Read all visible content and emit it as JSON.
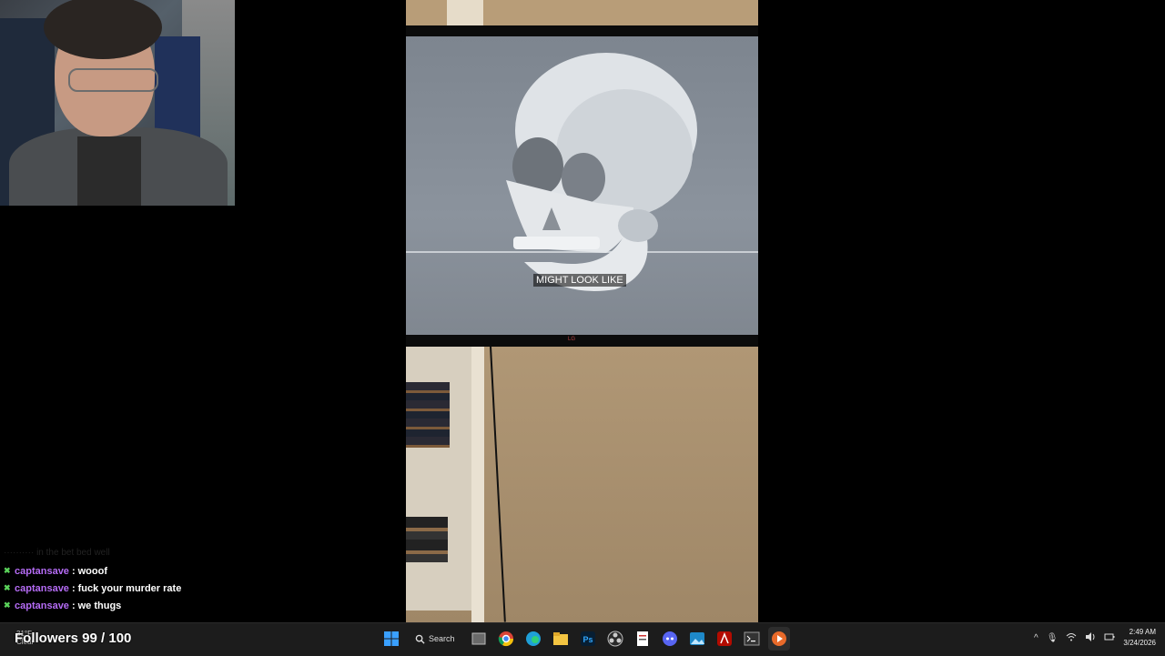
{
  "video": {
    "subtitle": "MIGHT LOOK LIKE"
  },
  "chat": {
    "faded_line": "·········· in the bet bed well",
    "messages": [
      {
        "user": "captansave",
        "text": "wooof"
      },
      {
        "user": "captansave",
        "text": "fuck your murder rate"
      },
      {
        "user": "captansave",
        "text": "we thugs"
      }
    ]
  },
  "overlay": {
    "followers": "Followers 99 / 100"
  },
  "taskbar": {
    "weather_temp": "31°F",
    "weather_label": "Clear",
    "search_label": "Search",
    "time": "2:49 AM",
    "date": "3/24/2026",
    "apps": [
      "windows-start",
      "search",
      "task-view",
      "chrome",
      "edge",
      "file-explorer",
      "photoshop",
      "obs",
      "notepad",
      "discord",
      "photos",
      "adobe-acrobat",
      "terminal",
      "media-player"
    ]
  },
  "colors": {
    "chat_user": "#b56cf5",
    "chat_badge": "#5bd45b",
    "taskbar_bg": "#1c1c1c"
  }
}
